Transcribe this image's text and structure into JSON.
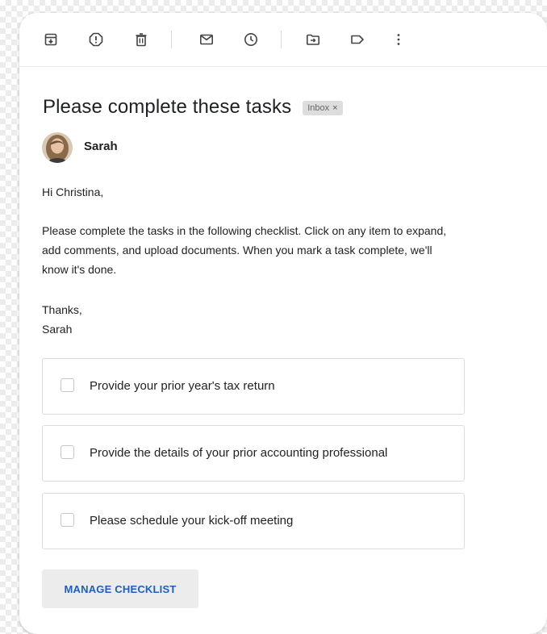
{
  "toolbar": {
    "icons": [
      "archive-icon",
      "report-spam-icon",
      "delete-icon",
      "mark-unread-icon",
      "snooze-icon",
      "move-to-icon",
      "label-icon",
      "more-options-icon"
    ]
  },
  "email": {
    "subject": "Please complete these tasks",
    "label_chip": "Inbox",
    "label_chip_close": "×",
    "sender": "Sarah",
    "greeting": "Hi Christina,",
    "body_lines": [
      "Please complete the tasks in the following checklist. Click on any item to expand,",
      "add comments, and upload documents. When you mark a task complete, we'll",
      "know it's done."
    ],
    "signoff": "Thanks,",
    "signature": "Sarah"
  },
  "checklist": {
    "tasks": [
      {
        "label": "Provide your prior year's tax return",
        "checked": false
      },
      {
        "label": "Provide the details of your prior accounting professional",
        "checked": false
      },
      {
        "label": "Please schedule your kick-off meeting",
        "checked": false
      }
    ],
    "manage_label": "MANAGE CHECKLIST"
  },
  "colors": {
    "accent": "#1a5fc8",
    "text": "#202124",
    "chip_bg": "#dddddd",
    "button_bg": "#ececec"
  }
}
